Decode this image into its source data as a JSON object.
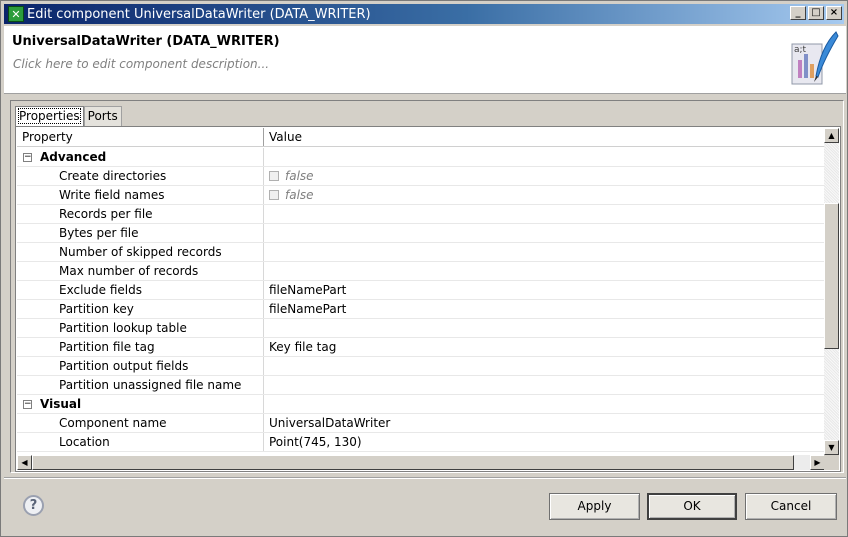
{
  "window": {
    "title": "Edit component UniversalDataWriter (DATA_WRITER)",
    "minimize": "_",
    "maximize": "□",
    "close": "×"
  },
  "header": {
    "component_name": "UniversalDataWriter (DATA_WRITER)",
    "description_placeholder": "Click here to edit component description..."
  },
  "tabs": [
    {
      "label": "Properties",
      "active": true
    },
    {
      "label": "Ports",
      "active": false
    }
  ],
  "table": {
    "columns": [
      "Property",
      "Value"
    ],
    "rows": [
      {
        "type": "group",
        "expander": "−",
        "label": "Advanced",
        "value": ""
      },
      {
        "type": "item",
        "label": "Create directories",
        "value": "false",
        "checkbox": true
      },
      {
        "type": "item",
        "label": "Write field names",
        "value": "false",
        "checkbox": true
      },
      {
        "type": "item",
        "label": "Records per file",
        "value": ""
      },
      {
        "type": "item",
        "label": "Bytes per file",
        "value": ""
      },
      {
        "type": "item",
        "label": "Number of skipped records",
        "value": ""
      },
      {
        "type": "item",
        "label": "Max number of records",
        "value": ""
      },
      {
        "type": "item",
        "label": "Exclude fields",
        "value": "fileNamePart"
      },
      {
        "type": "item",
        "label": "Partition key",
        "value": "fileNamePart"
      },
      {
        "type": "item",
        "label": "Partition lookup table",
        "value": ""
      },
      {
        "type": "item",
        "label": "Partition file tag",
        "value": "Key file tag"
      },
      {
        "type": "item",
        "label": "Partition output fields",
        "value": ""
      },
      {
        "type": "item",
        "label": "Partition unassigned file name",
        "value": ""
      },
      {
        "type": "group",
        "expander": "−",
        "label": "Visual",
        "value": ""
      },
      {
        "type": "item",
        "label": "Component name",
        "value": "UniversalDataWriter"
      },
      {
        "type": "item",
        "label": "Location",
        "value": "Point(745, 130)"
      }
    ]
  },
  "footer": {
    "help": "?",
    "apply_label": "Apply",
    "ok_label": "OK",
    "cancel_label": "Cancel"
  }
}
